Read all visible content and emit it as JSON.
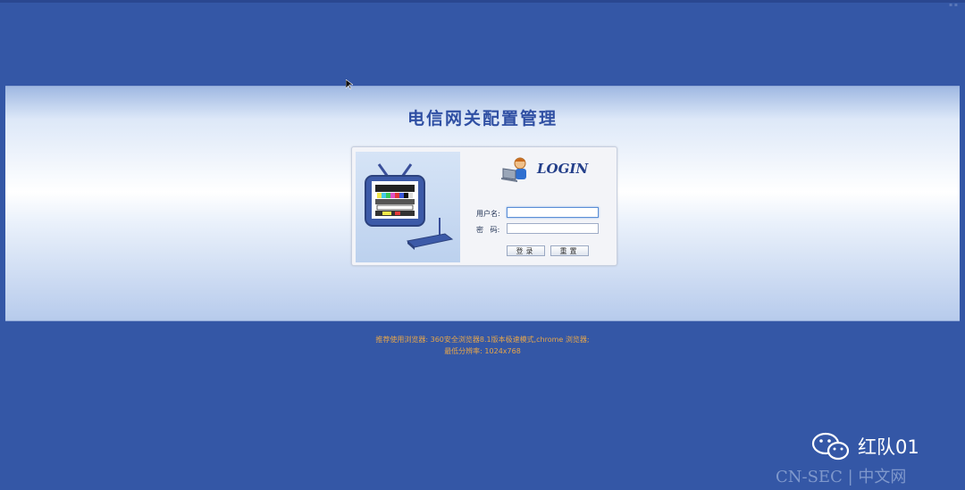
{
  "page": {
    "title": "电信网关配置管理",
    "login_heading": "LOGIN"
  },
  "form": {
    "username_label": "用户名:",
    "password_label": "密   码:",
    "username_value": "",
    "password_value": "",
    "login_button": "登录",
    "reset_button": "重置"
  },
  "footer": {
    "browser_note": "推荐使用浏览器: 360安全浏览器8.1版本极速模式,chrome 浏览器;",
    "resolution_note": "最低分辨率: 1024x768"
  },
  "watermark": {
    "account": "红队01",
    "site": "CN-SEC | 中文网"
  },
  "colors": {
    "background": "#3457a6",
    "title": "#2f4fa3",
    "note": "#e7a64a"
  }
}
